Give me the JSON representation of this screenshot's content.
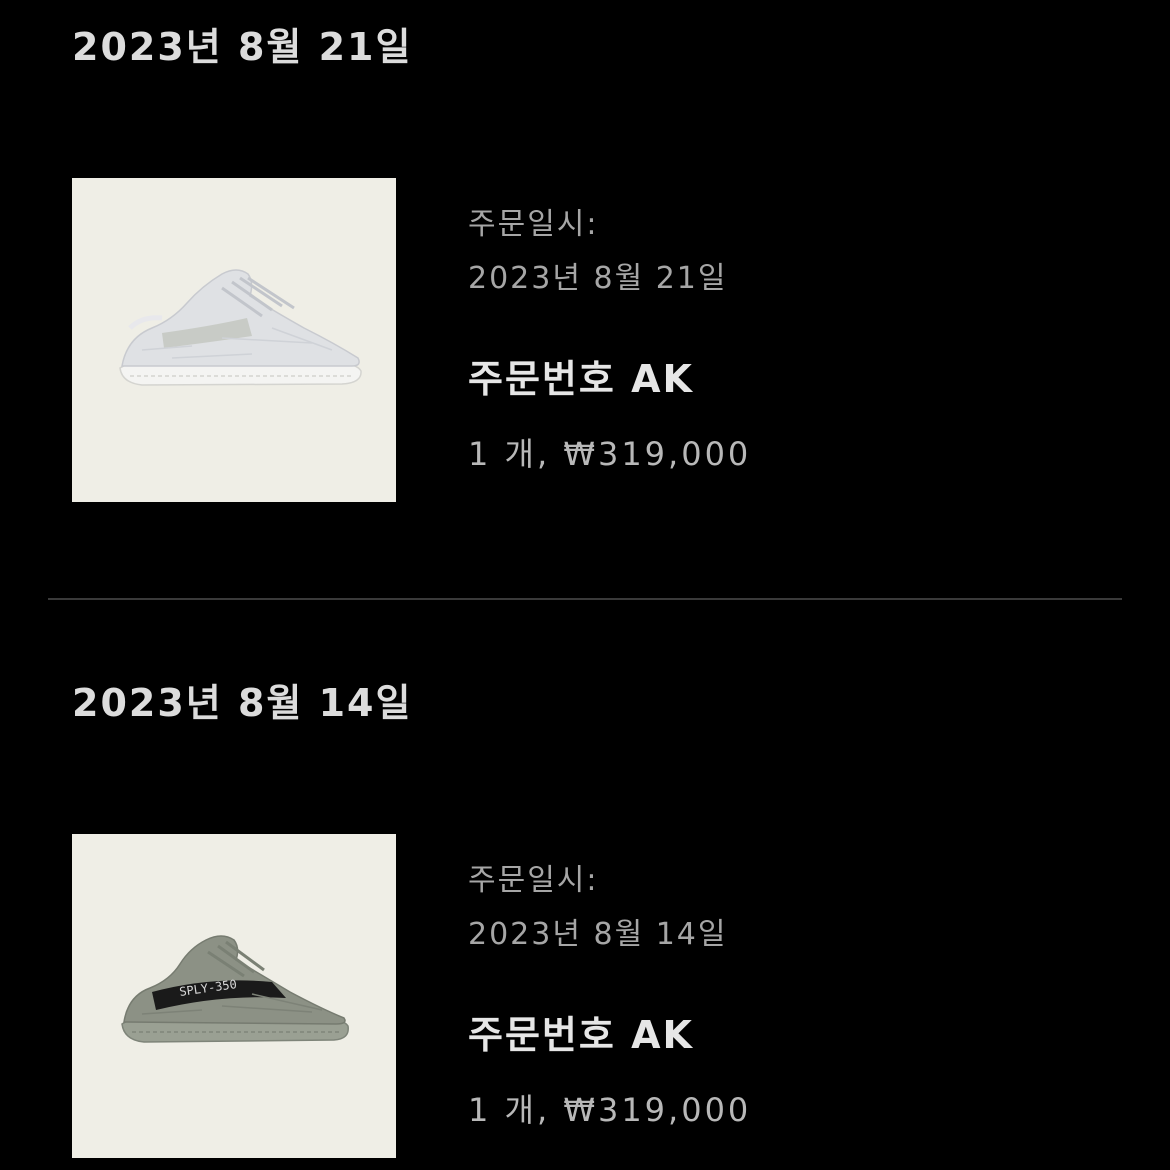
{
  "orders": [
    {
      "group_date": "2023년 8월 21일",
      "order_date_label": "주문일시:",
      "order_date": "2023년 8월 21일",
      "order_number_label": "주문번호",
      "order_number_visible": "AK",
      "quantity_price": "1 개, ₩319,000",
      "thumbnail": "sneaker-white-image",
      "colors": {
        "bg": "#efeee6",
        "shoe": "#dfe1e4",
        "sole": "#f4f4f2",
        "stripe": "#c5c9c2"
      }
    },
    {
      "group_date": "2023년 8월 14일",
      "order_date_label": "주문일시:",
      "order_date": "2023년 8월 14일",
      "order_number_label": "주문번호",
      "order_number_visible": "AK",
      "quantity_price": "1 개, ₩319,000",
      "thumbnail": "sneaker-grey-image",
      "shoe_text": "SPLY-350",
      "colors": {
        "bg": "#efeee6",
        "shoe": "#8c9185",
        "sole": "#9aa093",
        "stripe": "#1a1a1a"
      }
    }
  ]
}
